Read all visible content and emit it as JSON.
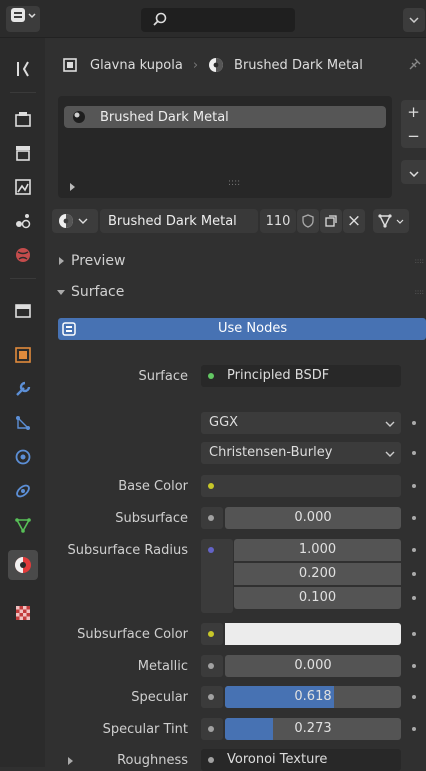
{
  "breadcrumb": {
    "object": "Glavna kupola",
    "separator": "›",
    "material": "Brushed Dark Metal"
  },
  "slots": [
    {
      "name": "Brushed Dark Metal"
    }
  ],
  "slot_panel": {
    "handle": "::::"
  },
  "side_buttons": {
    "add": "+",
    "remove": "−",
    "menu": "⌄"
  },
  "material_bar": {
    "name": "Brushed Dark Metal",
    "users": "110",
    "close": "×"
  },
  "panels": {
    "preview": "Preview",
    "surface": "Surface"
  },
  "use_nodes": "Use Nodes",
  "surface": {
    "label": "Surface",
    "value": "Principled BSDF"
  },
  "distribution": "GGX",
  "subsurface_method": "Christensen-Burley",
  "props": {
    "base_color": "Base Color",
    "subsurface": {
      "label": "Subsurface",
      "value": "0.000"
    },
    "subsurface_radius": {
      "label": "Subsurface Radius",
      "values": [
        "1.000",
        "0.200",
        "0.100"
      ]
    },
    "subsurface_color": "Subsurface Color",
    "metallic": {
      "label": "Metallic",
      "value": "0.000"
    },
    "specular": {
      "label": "Specular",
      "value": "0.618",
      "fill": 0.618
    },
    "specular_tint": {
      "label": "Specular Tint",
      "value": "0.273",
      "fill": 0.273
    },
    "roughness": {
      "label": "Roughness",
      "value": "Voronoi Texture"
    }
  },
  "colors": {
    "accent": "#4772b3",
    "shader_socket": "#63c763",
    "color_socket": "#c7c729",
    "vector_socket": "#6363c7",
    "float_socket": "#a1a1a1"
  }
}
